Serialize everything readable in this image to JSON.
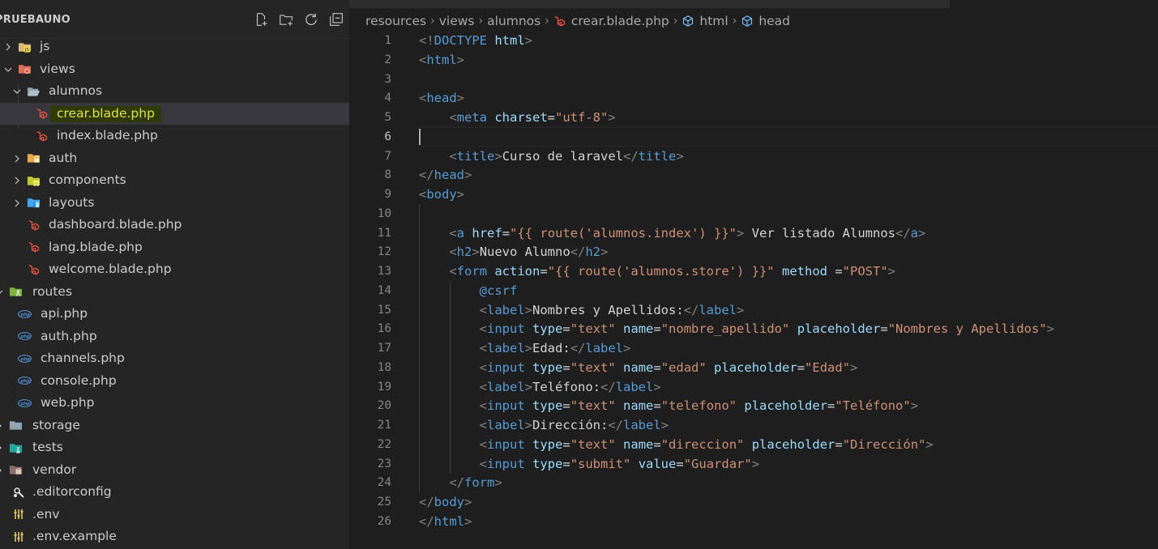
{
  "explorer": {
    "title": "PRUEBAUNO",
    "actions": [
      {
        "name": "new-file-icon"
      },
      {
        "name": "new-folder-icon"
      },
      {
        "name": "refresh-icon"
      },
      {
        "name": "collapse-all-icon"
      }
    ],
    "items": [
      {
        "label": "js",
        "icon": "folder-js",
        "expanded": false,
        "selected": false
      },
      {
        "label": "views",
        "icon": "folder-views",
        "expanded": true,
        "selected": false
      },
      {
        "label": "alumnos",
        "icon": "folder-open",
        "expanded": true,
        "selected": false
      },
      {
        "label": "crear.blade.php",
        "icon": "laravel-blade",
        "selected": true,
        "highlighted": true
      },
      {
        "label": "index.blade.php",
        "icon": "laravel-blade",
        "selected": false
      },
      {
        "label": "auth",
        "icon": "folder-auth",
        "expanded": false,
        "selected": false
      },
      {
        "label": "components",
        "icon": "folder-components",
        "expanded": false,
        "selected": false
      },
      {
        "label": "layouts",
        "icon": "folder-layouts",
        "expanded": false,
        "selected": false
      },
      {
        "label": "dashboard.blade.php",
        "icon": "laravel-blade",
        "selected": false
      },
      {
        "label": "lang.blade.php",
        "icon": "laravel-blade",
        "selected": false
      },
      {
        "label": "welcome.blade.php",
        "icon": "laravel-blade",
        "selected": false
      },
      {
        "label": "routes",
        "icon": "folder-routes",
        "expanded": true,
        "selected": false
      },
      {
        "label": "api.php",
        "icon": "php",
        "selected": false
      },
      {
        "label": "auth.php",
        "icon": "php",
        "selected": false
      },
      {
        "label": "channels.php",
        "icon": "php",
        "selected": false
      },
      {
        "label": "console.php",
        "icon": "php",
        "selected": false
      },
      {
        "label": "web.php",
        "icon": "php",
        "selected": false
      },
      {
        "label": "storage",
        "icon": "folder-plain",
        "expanded": false,
        "selected": false
      },
      {
        "label": "tests",
        "icon": "folder-tests",
        "expanded": false,
        "selected": false
      },
      {
        "label": "vendor",
        "icon": "folder-vendor",
        "expanded": false,
        "selected": false
      },
      {
        "label": ".editorconfig",
        "icon": "editorconfig",
        "selected": false
      },
      {
        "label": ".env",
        "icon": "env",
        "selected": false
      },
      {
        "label": ".env.example",
        "icon": "env",
        "selected": false
      }
    ]
  },
  "breadcrumb": [
    {
      "label": "resources",
      "icon": ""
    },
    {
      "label": "views",
      "icon": ""
    },
    {
      "label": "alumnos",
      "icon": ""
    },
    {
      "label": "crear.blade.php",
      "icon": "laravel-blade"
    },
    {
      "label": "html",
      "icon": "symbol-cube"
    },
    {
      "label": "head",
      "icon": "symbol-cube"
    }
  ],
  "editor": {
    "active_line": 6,
    "lines": [
      [
        [
          "<!",
          "ang"
        ],
        [
          "DOCTYPE",
          "tag"
        ],
        [
          " ",
          "txt"
        ],
        [
          "html",
          "bold"
        ],
        [
          ">",
          "ang"
        ]
      ],
      [
        [
          "<",
          "ang"
        ],
        [
          "html",
          "tag"
        ],
        [
          ">",
          "ang"
        ]
      ],
      [],
      [
        [
          "<",
          "ang"
        ],
        [
          "head",
          "tag"
        ],
        [
          ">",
          "ang"
        ]
      ],
      [
        [
          "    ",
          "txt"
        ],
        [
          "<",
          "ang"
        ],
        [
          "meta",
          "tag"
        ],
        [
          " ",
          "txt"
        ],
        [
          "charset",
          "attr"
        ],
        [
          "=",
          "txt"
        ],
        [
          "\"utf-8\"",
          "str"
        ],
        [
          ">",
          "ang"
        ]
      ],
      [],
      [
        [
          "    ",
          "txt"
        ],
        [
          "<",
          "ang"
        ],
        [
          "title",
          "tag"
        ],
        [
          ">",
          "ang"
        ],
        [
          "Curso de laravel",
          "txt"
        ],
        [
          "</",
          "ang"
        ],
        [
          "title",
          "tag"
        ],
        [
          ">",
          "ang"
        ]
      ],
      [
        [
          "</",
          "ang"
        ],
        [
          "head",
          "tag"
        ],
        [
          ">",
          "ang"
        ]
      ],
      [
        [
          "<",
          "ang"
        ],
        [
          "body",
          "tag"
        ],
        [
          ">",
          "ang"
        ]
      ],
      [],
      [
        [
          "    ",
          "txt"
        ],
        [
          "<",
          "ang"
        ],
        [
          "a",
          "tag"
        ],
        [
          " ",
          "txt"
        ],
        [
          "href",
          "attr"
        ],
        [
          "=",
          "txt"
        ],
        [
          "\"{{ route('alumnos.index') }}\"",
          "str"
        ],
        [
          ">",
          "ang"
        ],
        [
          " Ver listado Alumnos",
          "txt"
        ],
        [
          "</",
          "ang"
        ],
        [
          "a",
          "tag"
        ],
        [
          ">",
          "ang"
        ]
      ],
      [
        [
          "    ",
          "txt"
        ],
        [
          "<",
          "ang"
        ],
        [
          "h2",
          "tag"
        ],
        [
          ">",
          "ang"
        ],
        [
          "Nuevo Alumno",
          "txt"
        ],
        [
          "</",
          "ang"
        ],
        [
          "h2",
          "tag"
        ],
        [
          ">",
          "ang"
        ]
      ],
      [
        [
          "    ",
          "txt"
        ],
        [
          "<",
          "ang"
        ],
        [
          "form",
          "tag"
        ],
        [
          " ",
          "txt"
        ],
        [
          "action",
          "attr"
        ],
        [
          "=",
          "txt"
        ],
        [
          "\"{{ route('alumnos.store') }}\"",
          "str"
        ],
        [
          " ",
          "txt"
        ],
        [
          "method",
          "attr"
        ],
        [
          " =",
          "txt"
        ],
        [
          "\"POST\"",
          "str"
        ],
        [
          ">",
          "ang"
        ]
      ],
      [
        [
          "        ",
          "txt"
        ],
        [
          "@csrf",
          "dir"
        ]
      ],
      [
        [
          "        ",
          "txt"
        ],
        [
          "<",
          "ang"
        ],
        [
          "label",
          "tag"
        ],
        [
          ">",
          "ang"
        ],
        [
          "Nombres y Apellidos:",
          "txt"
        ],
        [
          "</",
          "ang"
        ],
        [
          "label",
          "tag"
        ],
        [
          ">",
          "ang"
        ]
      ],
      [
        [
          "        ",
          "txt"
        ],
        [
          "<",
          "ang"
        ],
        [
          "input",
          "tag"
        ],
        [
          " ",
          "txt"
        ],
        [
          "type",
          "attr"
        ],
        [
          "=",
          "txt"
        ],
        [
          "\"text\"",
          "str"
        ],
        [
          " ",
          "txt"
        ],
        [
          "name",
          "attr"
        ],
        [
          "=",
          "txt"
        ],
        [
          "\"nombre_apellido\"",
          "str"
        ],
        [
          " ",
          "txt"
        ],
        [
          "placeholder",
          "attr"
        ],
        [
          "=",
          "txt"
        ],
        [
          "\"Nombres y Apellidos\"",
          "str"
        ],
        [
          ">",
          "ang"
        ]
      ],
      [
        [
          "        ",
          "txt"
        ],
        [
          "<",
          "ang"
        ],
        [
          "label",
          "tag"
        ],
        [
          ">",
          "ang"
        ],
        [
          "Edad:",
          "txt"
        ],
        [
          "</",
          "ang"
        ],
        [
          "label",
          "tag"
        ],
        [
          ">",
          "ang"
        ]
      ],
      [
        [
          "        ",
          "txt"
        ],
        [
          "<",
          "ang"
        ],
        [
          "input",
          "tag"
        ],
        [
          " ",
          "txt"
        ],
        [
          "type",
          "attr"
        ],
        [
          "=",
          "txt"
        ],
        [
          "\"text\"",
          "str"
        ],
        [
          " ",
          "txt"
        ],
        [
          "name",
          "attr"
        ],
        [
          "=",
          "txt"
        ],
        [
          "\"edad\"",
          "str"
        ],
        [
          " ",
          "txt"
        ],
        [
          "placeholder",
          "attr"
        ],
        [
          "=",
          "txt"
        ],
        [
          "\"Edad\"",
          "str"
        ],
        [
          ">",
          "ang"
        ]
      ],
      [
        [
          "        ",
          "txt"
        ],
        [
          "<",
          "ang"
        ],
        [
          "label",
          "tag"
        ],
        [
          ">",
          "ang"
        ],
        [
          "Teléfono:",
          "txt"
        ],
        [
          "</",
          "ang"
        ],
        [
          "label",
          "tag"
        ],
        [
          ">",
          "ang"
        ]
      ],
      [
        [
          "        ",
          "txt"
        ],
        [
          "<",
          "ang"
        ],
        [
          "input",
          "tag"
        ],
        [
          " ",
          "txt"
        ],
        [
          "type",
          "attr"
        ],
        [
          "=",
          "txt"
        ],
        [
          "\"text\"",
          "str"
        ],
        [
          " ",
          "txt"
        ],
        [
          "name",
          "attr"
        ],
        [
          "=",
          "txt"
        ],
        [
          "\"telefono\"",
          "str"
        ],
        [
          " ",
          "txt"
        ],
        [
          "placeholder",
          "attr"
        ],
        [
          "=",
          "txt"
        ],
        [
          "\"Teléfono\"",
          "str"
        ],
        [
          ">",
          "ang"
        ]
      ],
      [
        [
          "        ",
          "txt"
        ],
        [
          "<",
          "ang"
        ],
        [
          "label",
          "tag"
        ],
        [
          ">",
          "ang"
        ],
        [
          "Dirección:",
          "txt"
        ],
        [
          "</",
          "ang"
        ],
        [
          "label",
          "tag"
        ],
        [
          ">",
          "ang"
        ]
      ],
      [
        [
          "        ",
          "txt"
        ],
        [
          "<",
          "ang"
        ],
        [
          "input",
          "tag"
        ],
        [
          " ",
          "txt"
        ],
        [
          "type",
          "attr"
        ],
        [
          "=",
          "txt"
        ],
        [
          "\"text\"",
          "str"
        ],
        [
          " ",
          "txt"
        ],
        [
          "name",
          "attr"
        ],
        [
          "=",
          "txt"
        ],
        [
          "\"direccion\"",
          "str"
        ],
        [
          " ",
          "txt"
        ],
        [
          "placeholder",
          "attr"
        ],
        [
          "=",
          "txt"
        ],
        [
          "\"Dirección\"",
          "str"
        ],
        [
          ">",
          "ang"
        ]
      ],
      [
        [
          "        ",
          "txt"
        ],
        [
          "<",
          "ang"
        ],
        [
          "input",
          "tag"
        ],
        [
          " ",
          "txt"
        ],
        [
          "type",
          "attr"
        ],
        [
          "=",
          "txt"
        ],
        [
          "\"submit\"",
          "str"
        ],
        [
          " ",
          "txt"
        ],
        [
          "value",
          "attr"
        ],
        [
          "=",
          "txt"
        ],
        [
          "\"Guardar\"",
          "str"
        ],
        [
          ">",
          "ang"
        ]
      ],
      [
        [
          "    ",
          "txt"
        ],
        [
          "</",
          "ang"
        ],
        [
          "form",
          "tag"
        ],
        [
          ">",
          "ang"
        ]
      ],
      [
        [
          "</",
          "ang"
        ],
        [
          "body",
          "tag"
        ],
        [
          ">",
          "ang"
        ]
      ],
      [
        [
          "</",
          "ang"
        ],
        [
          "html",
          "tag"
        ],
        [
          ">",
          "ang"
        ]
      ]
    ]
  },
  "colors": {
    "sidebar_bg": "#252526",
    "editor_bg": "#1e1e1e",
    "selection_bg": "#37373d",
    "highlight_text": "#e2e24a",
    "laravel_red": "#f05340",
    "php_blue": "#4f8ccf",
    "folder_yellow": "#dcb67a"
  }
}
